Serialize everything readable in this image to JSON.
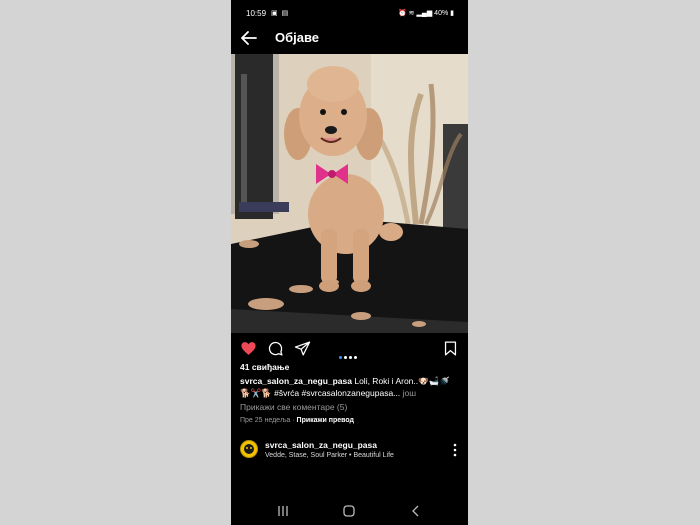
{
  "status_bar": {
    "time": "10:59",
    "battery": "40%",
    "icons": [
      "gallery-icon",
      "screenshot-icon",
      "alarm-icon",
      "wifi-icon",
      "signal-icon",
      "battery-icon"
    ]
  },
  "header": {
    "title": "Објаве",
    "back_icon": "arrow-left-icon"
  },
  "post": {
    "image_icon": "poodle-photo",
    "actions": [
      "heart-icon",
      "comment-icon",
      "share-icon",
      "bookmark-icon"
    ],
    "liked": true,
    "like_color": "#ed4956",
    "carousel": {
      "count": 4,
      "active": 1
    },
    "likes_text": "41 свиђање",
    "caption_user": "svrca_salon_za_negu_pasa",
    "caption_text": " Loli, Roki i Aron..🐶🛁🚿",
    "caption_line2": "🐕✂️🐕 #švrća #svrcasalonzanegupasa...",
    "caption_more": " још",
    "view_comments": "Прикажи све коментаре (5)",
    "time_ago": "Пре 25 недеља",
    "separator": " · ",
    "translate": "Прикажи превод"
  },
  "audio": {
    "username": "svrca_salon_za_negu_pasa",
    "music": "Vedde, Stase, Soul Parker • Beautiful Life",
    "more_icon": "more-vertical-icon"
  },
  "nav": [
    "recents-icon",
    "home-icon",
    "back-icon"
  ]
}
